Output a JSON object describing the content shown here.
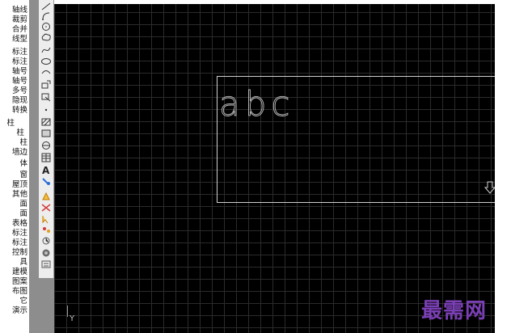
{
  "side_menu": {
    "items": [
      "轴线",
      "裁剪",
      "合并",
      "线型",
      "标注",
      "标注",
      "轴号",
      "轴号",
      "多号",
      "隐现",
      "转换",
      "柱",
      "柱",
      "柱",
      "墙边",
      "体",
      "窗",
      "屋顶",
      "其他",
      "面",
      "面",
      "表格",
      "标注",
      "标注",
      "控制",
      "具",
      "建模",
      "图案",
      "布图",
      "它",
      "演示"
    ]
  },
  "tool_palette": {
    "icons": [
      "line-tool-icon",
      "arc-tool-icon",
      "circle-tool-icon",
      "cloud-tool-icon",
      "spline-tool-icon",
      "ellipse-tool-icon",
      "ellipse-arc-tool-icon",
      "insert-block-icon",
      "make-block-icon",
      "point-tool-icon",
      "hatch-tool-icon",
      "gradient-tool-icon",
      "region-tool-icon",
      "table-tool-icon",
      "text-tool-icon",
      "text-edit-icon",
      "match-props-icon",
      "match-props-2-icon",
      "select-icon",
      "select-2-icon",
      "properties-icon",
      "layer-icon",
      "layer-2-icon"
    ]
  },
  "canvas": {
    "sample_text": "abc",
    "axis_label": "Y",
    "watermark": "最需网"
  },
  "colors": {
    "canvas_bg": "#000000",
    "grid": "#2b2b2b",
    "frame": "#cfcfcf",
    "watermark": "#7b3fb5"
  }
}
